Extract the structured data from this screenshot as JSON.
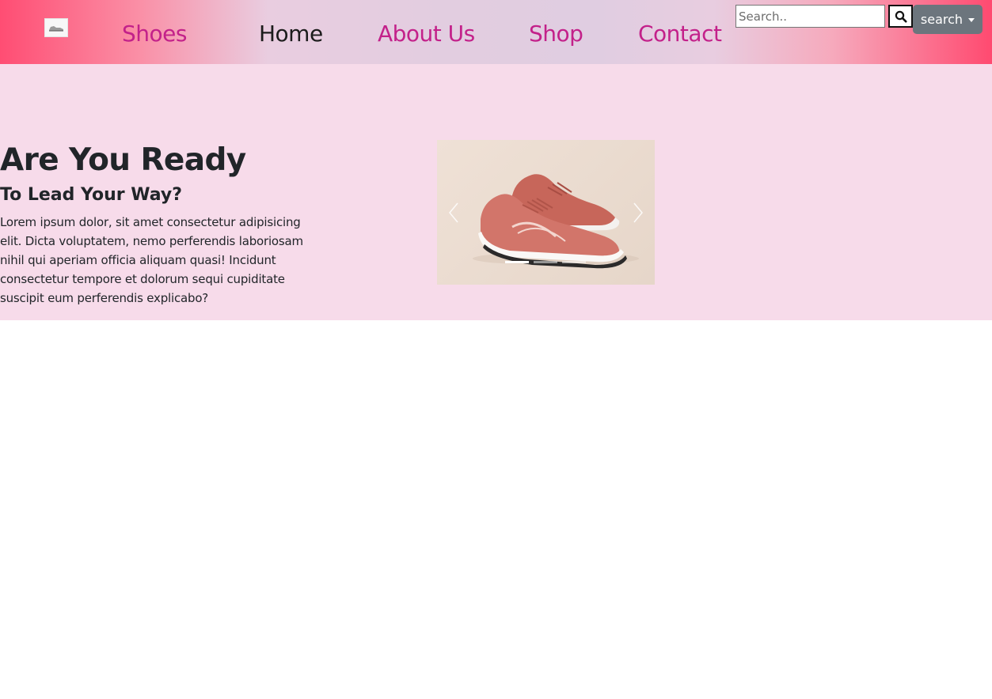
{
  "nav": {
    "logo_alt": "Shoes logo",
    "links": [
      {
        "label": "Shoes",
        "active": false
      },
      {
        "label": "Home",
        "active": true
      },
      {
        "label": "About Us",
        "active": false
      },
      {
        "label": "Shop",
        "active": false
      },
      {
        "label": "Contact",
        "active": false
      }
    ],
    "search": {
      "placeholder": "Search..",
      "value": "",
      "icon": "search-icon",
      "dropdown_label": "search"
    }
  },
  "hero": {
    "title": "Are You Ready",
    "subtitle": "To Lead Your Way?",
    "text": "Lorem ipsum dolor, sit amet consectetur adipisicing elit. Dicta voluptatem, nemo perferendis laboriosam nihil qui aperiam officia aliquam quasi! Incidunt consectetur tempore et dolorum sequi cupiditate suscipit eum perferendis explicabo?"
  },
  "carousel": {
    "slide_count": 3,
    "active_index": 0,
    "prev_icon": "chevron-left-icon",
    "next_icon": "chevron-right-icon"
  },
  "colors": {
    "nav_link": "#c3218a",
    "nav_link_active": "#1c1c1c",
    "hero_bg": "#f7dbea",
    "dropdown_bg": "#6c757d"
  }
}
